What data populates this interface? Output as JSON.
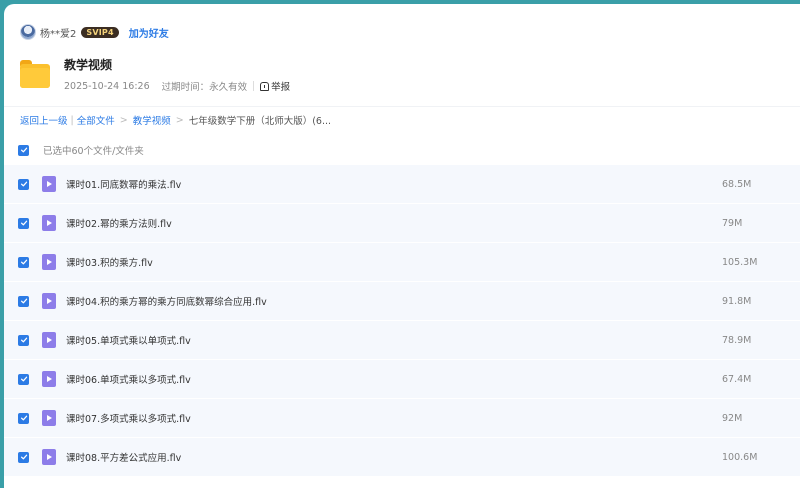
{
  "user": {
    "name": "杨**爱2",
    "badge": "SVIP4",
    "add_friend_label": "加为好友"
  },
  "share": {
    "title": "教学视频",
    "date": "2025-10-24 16:26",
    "expire_label": "过期时间：永久有效",
    "report_label": "举报"
  },
  "breadcrumb": {
    "back": "返回上一级",
    "all_files": "全部文件",
    "folder": "教学视频",
    "current": "七年级数学下册（北师大版）(6..."
  },
  "selection": {
    "label": "已选中60个文件/文件夹"
  },
  "files": [
    {
      "name": "课时01.同底数幂的乘法.flv",
      "size": "68.5M"
    },
    {
      "name": "课时02.幂的乘方法则.flv",
      "size": "79M"
    },
    {
      "name": "课时03.积的乘方.flv",
      "size": "105.3M"
    },
    {
      "name": "课时04.积的乘方幂的乘方同底数幂综合应用.flv",
      "size": "91.8M"
    },
    {
      "name": "课时05.单项式乘以单项式.flv",
      "size": "78.9M"
    },
    {
      "name": "课时06.单项式乘以多项式.flv",
      "size": "67.4M"
    },
    {
      "name": "课时07.多项式乘以多项式.flv",
      "size": "92M"
    },
    {
      "name": "课时08.平方差公式应用.flv",
      "size": "100.6M"
    }
  ],
  "colors": {
    "accent": "#2c7be5",
    "background_frame": "#3a9fa8",
    "row_bg": "#f5f8fd",
    "video_icon": "#8d7de9",
    "folder": "#ffca3a"
  },
  "icons": {
    "avatar": "user-avatar",
    "folder": "folder-icon",
    "report": "report-icon",
    "checkbox": "checkbox-checked-icon",
    "file": "video-file-icon"
  }
}
